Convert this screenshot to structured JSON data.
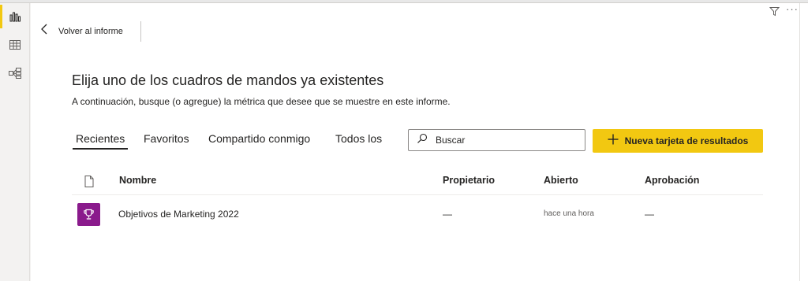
{
  "leftrail": {
    "items": [
      {
        "icon": "bar-chart-icon",
        "active": true
      },
      {
        "icon": "table-icon",
        "active": false
      },
      {
        "icon": "model-icon",
        "active": false
      }
    ]
  },
  "toolbar": {
    "filter_icon": "filter-icon",
    "more_icon": "more-icon",
    "more_label": "···"
  },
  "back": {
    "label": "Volver al informe"
  },
  "header": {
    "title": "Elija uno de los cuadros de mandos ya existentes",
    "subtitle": "A continuación, busque (o agregue) la métrica que desee que se muestre en este informe."
  },
  "tabs": [
    {
      "label": "Recientes",
      "active": true
    },
    {
      "label": "Favoritos",
      "active": false
    },
    {
      "label": "Compartido conmigo",
      "active": false
    },
    {
      "label": "Todos los",
      "active": false
    }
  ],
  "search": {
    "placeholder": "Buscar",
    "value": ""
  },
  "new_button": {
    "label": "Nueva tarjeta de resultados"
  },
  "table": {
    "columns": [
      "Nombre",
      "Propietario",
      "Abierto",
      "Aprobación"
    ],
    "rows": [
      {
        "icon": "trophy-icon",
        "name": "Objetivos de Marketing 2022",
        "owner": "—",
        "opened": "hace una hora",
        "approval": "—"
      }
    ]
  },
  "colors": {
    "accent": "#f2c811",
    "scorecard_icon_bg": "#8a1a8c"
  }
}
